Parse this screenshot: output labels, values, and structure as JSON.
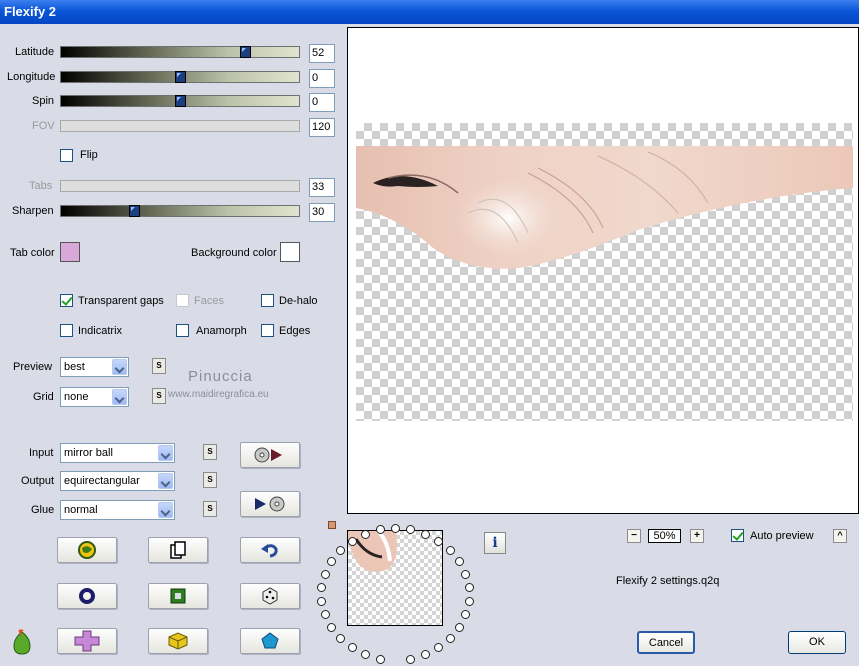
{
  "window": {
    "title": "Flexify 2"
  },
  "params": {
    "latitude": {
      "label": "Latitude",
      "value": "52",
      "level": 0.78
    },
    "longitude": {
      "label": "Longitude",
      "value": "0",
      "level": 0.5
    },
    "spin": {
      "label": "Spin",
      "value": "0",
      "level": 0.5
    },
    "fov": {
      "label": "FOV",
      "value": "120"
    },
    "flip": {
      "label": "Flip",
      "checked": false
    },
    "tabs": {
      "label": "Tabs",
      "value": "33"
    },
    "sharpen": {
      "label": "Sharpen",
      "value": "30",
      "level": 0.3
    }
  },
  "colors": {
    "tab_color": {
      "label": "Tab color",
      "hex": "#d8a8d8"
    },
    "background_color": {
      "label": "Background color",
      "hex": "#ffffff"
    }
  },
  "options": {
    "transparent_gaps": "Transparent gaps",
    "faces": "Faces",
    "dehalo": "De-halo",
    "indicatrix": "Indicatrix",
    "anamorph": "Anamorph",
    "edges": "Edges"
  },
  "preview_select": {
    "label": "Preview",
    "value": "best"
  },
  "grid_select": {
    "label": "Grid",
    "value": "none"
  },
  "input_select": {
    "label": "Input",
    "value": "mirror ball"
  },
  "output_select": {
    "label": "Output",
    "value": "equirectangular"
  },
  "glue_select": {
    "label": "Glue",
    "value": "normal"
  },
  "sbtn_label": "S",
  "watermark": {
    "name": "Pinuccia",
    "site": "www.maidiregrafica.eu"
  },
  "zoom": {
    "value": "50%",
    "minus": "−",
    "plus": "+"
  },
  "auto_preview": {
    "label": "Auto preview",
    "checked": true,
    "collapse": "^"
  },
  "settings_file": "Flexify 2 settings.q2q",
  "info_label": "i",
  "buttons": {
    "cancel": "Cancel",
    "ok": "OK"
  }
}
